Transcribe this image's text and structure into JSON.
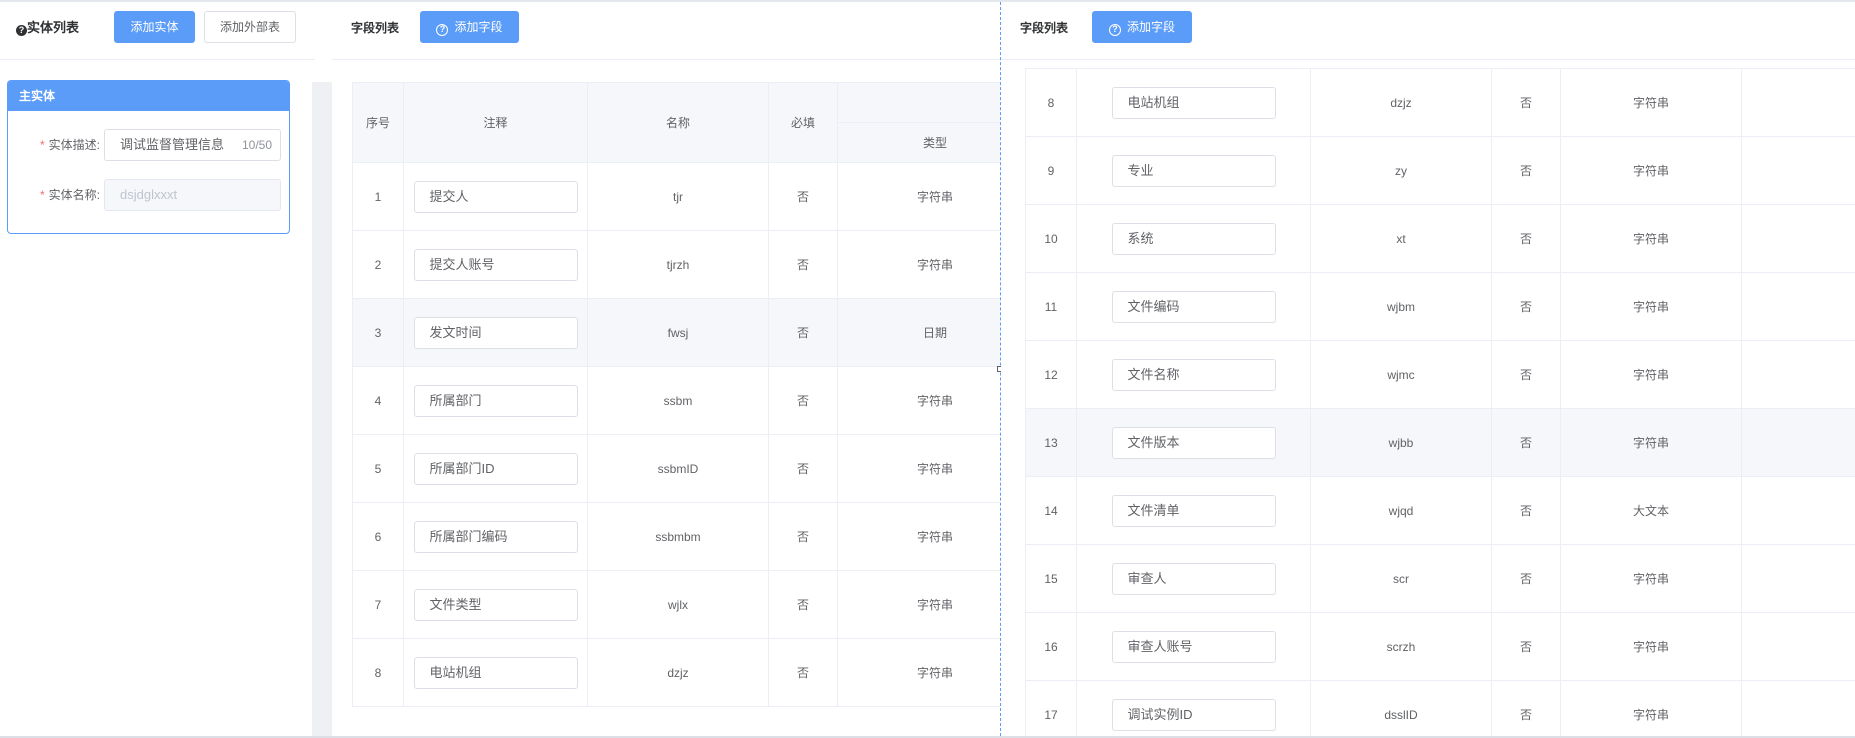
{
  "left": {
    "title": "实体列表",
    "add_entity_label": "添加实体",
    "add_external_label": "添加外部表",
    "card": {
      "title": "主实体",
      "desc_label": "实体描述:",
      "desc_value": "调试监督管理信息",
      "desc_counter": "10/50",
      "name_label": "实体名称:",
      "name_placeholder": "dsjdglxxxt"
    }
  },
  "middle": {
    "title": "字段列表",
    "add_field_label": "添加字段",
    "headers": {
      "index": "序号",
      "comment": "注释",
      "name": "名称",
      "required": "必填",
      "type": "类型"
    },
    "rows": [
      {
        "index": "1",
        "comment": "提交人",
        "name": "tjr",
        "required": "否",
        "type": "字符串"
      },
      {
        "index": "2",
        "comment": "提交人账号",
        "name": "tjrzh",
        "required": "否",
        "type": "字符串"
      },
      {
        "index": "3",
        "comment": "发文时间",
        "name": "fwsj",
        "required": "否",
        "type": "日期"
      },
      {
        "index": "4",
        "comment": "所属部门",
        "name": "ssbm",
        "required": "否",
        "type": "字符串"
      },
      {
        "index": "5",
        "comment": "所属部门ID",
        "name": "ssbmID",
        "required": "否",
        "type": "字符串"
      },
      {
        "index": "6",
        "comment": "所属部门编码",
        "name": "ssbmbm",
        "required": "否",
        "type": "字符串"
      },
      {
        "index": "7",
        "comment": "文件类型",
        "name": "wjlx",
        "required": "否",
        "type": "字符串"
      },
      {
        "index": "8",
        "comment": "电站机组",
        "name": "dzjz",
        "required": "否",
        "type": "字符串"
      }
    ]
  },
  "right": {
    "title": "字段列表",
    "add_field_label": "添加字段",
    "rows": [
      {
        "index": "8",
        "comment": "电站机组",
        "name": "dzjz",
        "required": "否",
        "type": "字符串"
      },
      {
        "index": "9",
        "comment": "专业",
        "name": "zy",
        "required": "否",
        "type": "字符串"
      },
      {
        "index": "10",
        "comment": "系统",
        "name": "xt",
        "required": "否",
        "type": "字符串"
      },
      {
        "index": "11",
        "comment": "文件编码",
        "name": "wjbm",
        "required": "否",
        "type": "字符串"
      },
      {
        "index": "12",
        "comment": "文件名称",
        "name": "wjmc",
        "required": "否",
        "type": "字符串"
      },
      {
        "index": "13",
        "comment": "文件版本",
        "name": "wjbb",
        "required": "否",
        "type": "字符串"
      },
      {
        "index": "14",
        "comment": "文件清单",
        "name": "wjqd",
        "required": "否",
        "type": "大文本"
      },
      {
        "index": "15",
        "comment": "审查人",
        "name": "scr",
        "required": "否",
        "type": "字符串"
      },
      {
        "index": "16",
        "comment": "审查人账号",
        "name": "scrzh",
        "required": "否",
        "type": "字符串"
      },
      {
        "index": "17",
        "comment": "调试实例ID",
        "name": "dsslID",
        "required": "否",
        "type": "字符串"
      }
    ]
  },
  "colors": {
    "primary": "#5b9cf8",
    "border": "#ebeef5",
    "header_bg": "#f5f7fa",
    "required_mark": "#f56c6c"
  }
}
